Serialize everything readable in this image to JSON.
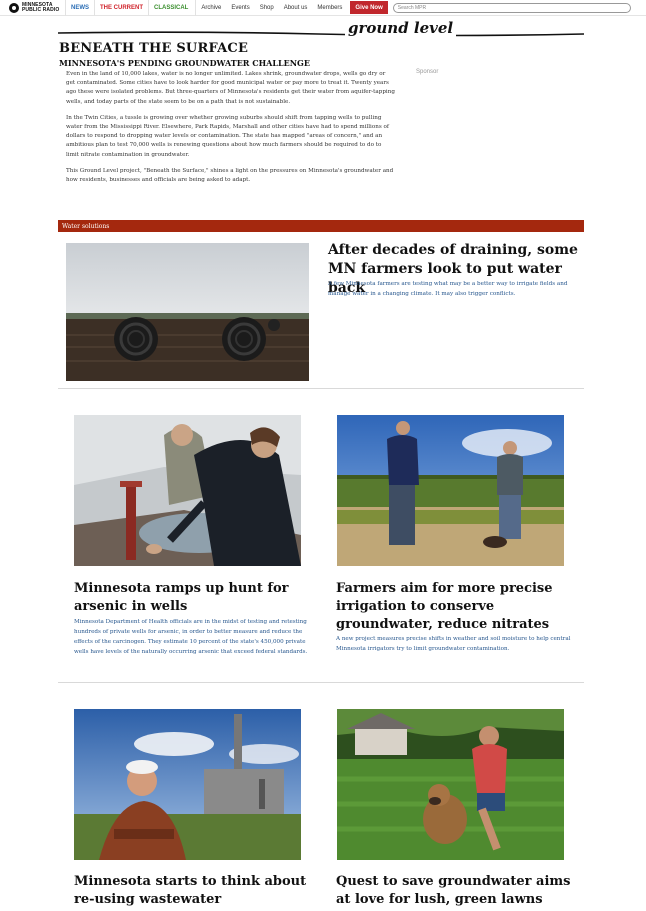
{
  "nav": {
    "logo_text": "MINNESOTA PUBLIC RADIO",
    "tabs": [
      "NEWS",
      "THE CURRENT",
      "CLASSICAL"
    ],
    "links": [
      "Archive",
      "Events",
      "Shop",
      "About us",
      "Members"
    ],
    "give_label": "Give Now",
    "search_placeholder": "Search MPR"
  },
  "brand": "ground level",
  "page": {
    "title": "BENEATH THE SURFACE",
    "subtitle": "MINNESOTA'S PENDING GROUNDWATER CHALLENGE",
    "sponsor": "Sponsor",
    "intro": [
      "Even in the land of 10,000 lakes, water is no longer unlimited. Lakes shrink, groundwater drops, wells go dry or get contaminated. Some cities have to look harder for good municipal water or pay more to treat it. Twenty years ago these were isolated problems. But three-quarters of Minnesota's residents get their water from aquifer-tapping wells, and today parts of the state seem to be on a path that is not sustainable.",
      "In the Twin Cities, a tussle is growing over whether growing suburbs should shift from tapping wells to pulling water from the Mississippi River. Elsewhere, Park Rapids, Marshall and other cities have had to spend millions of dollars to respond to dropping water levels or contamination. The state has mapped \"areas of concern,\" and an ambitious plan to test 70,000 wells is renewing questions about how much farmers should be required to do to limit nitrate contamination in groundwater.",
      "This Ground Level project, \"Beneath the Surface,\" shines a light on the pressures on Minnesota's groundwater and how residents, businesses and officials are being asked to adapt."
    ]
  },
  "section_label": "Water solutions",
  "stories": [
    {
      "headline": "After decades of draining, some MN farmers look to put water back",
      "summary": "A few Minnesota farmers are testing what may be a better way to irrigate fields and manage water in a changing climate. It may also trigger conflicts."
    },
    {
      "headline": "Minnesota ramps up hunt for arsenic in wells",
      "summary": "Minnesota Department of Health officials are in the midst of testing and retesting hundreds of private wells for arsenic, in order to better measure and reduce the effects of the carcinogen. They estimate 10 percent of the state's 450,000 private wells have levels of the naturally occurring arsenic that exceed federal standards."
    },
    {
      "headline": "Farmers aim for more precise irrigation to conserve groundwater, reduce nitrates",
      "summary": "A new project measures precise shifts in weather and soil moisture to help central Minnesota irrigators try to limit groundwater contamination."
    },
    {
      "headline": "Minnesota starts to think about re-using wastewater",
      "summary": ""
    },
    {
      "headline": "Quest to save groundwater aims at love for lush, green lawns",
      "summary": ""
    }
  ]
}
